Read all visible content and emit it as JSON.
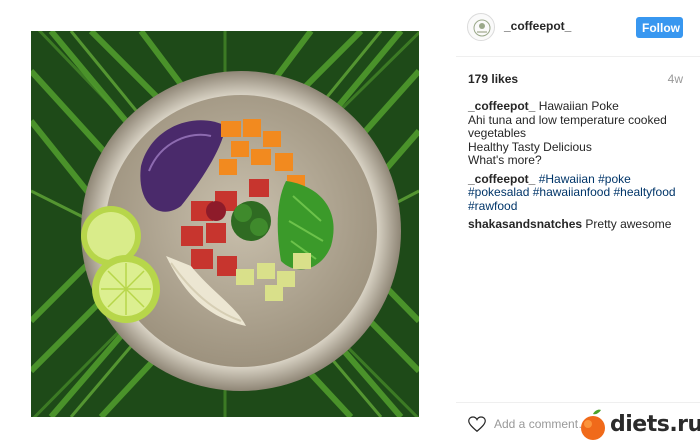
{
  "post": {
    "image_alt": "Hawaiian poke bowl on palm leaves"
  },
  "header": {
    "username": "_coffeepot_",
    "follow_label": "Follow"
  },
  "stats": {
    "likes": "179 likes",
    "age": "4w"
  },
  "caption": {
    "author": "_coffeepot_",
    "lines": [
      "Hawaiian Poke",
      "Ahi tuna and low temperature cooked vegetables",
      "Healthy Tasty Delicious",
      "What's more?"
    ]
  },
  "hashtag_comment": {
    "author": "_coffeepot_",
    "tags": [
      "#Hawaiian",
      "#poke",
      "#pokesalad",
      "#hawaiianfood",
      "#healtyfood",
      "#rawfood"
    ]
  },
  "reply": {
    "author": "shakasandsnatches",
    "text": "Pretty awesome"
  },
  "comment_box": {
    "placeholder": "Add a comment…"
  },
  "watermark": {
    "text": "diets.ru"
  },
  "colors": {
    "follow_button": "#3897f0",
    "hashtag": "#003569",
    "muted": "#999999"
  }
}
